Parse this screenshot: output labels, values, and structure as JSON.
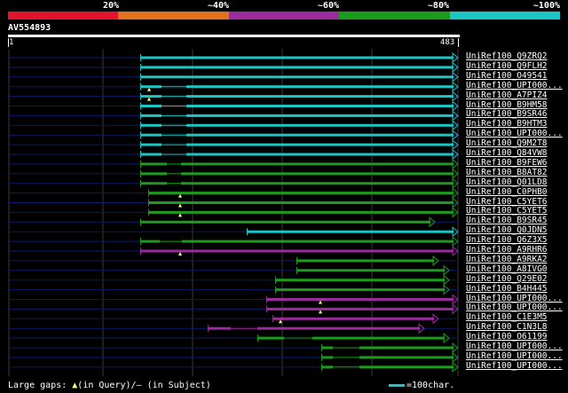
{
  "legend": {
    "segments": [
      {
        "label": "20%",
        "color": "#e4132c"
      },
      {
        "label": "~40%",
        "color": "#e2701d"
      },
      {
        "label": "~60%",
        "color": "#9b2c9d"
      },
      {
        "label": "~80%",
        "color": "#1c9b1c"
      },
      {
        "label": "~100%",
        "color": "#1cc6c6"
      }
    ]
  },
  "query": {
    "id": "AV554893",
    "start": "1",
    "end": "483"
  },
  "hits": [
    {
      "label": "UniRef100_Q9ZRQ2",
      "color": "cyan"
    },
    {
      "label": "UniRef100_Q9FLH2",
      "color": "cyan"
    },
    {
      "label": "UniRef100_O49541",
      "color": "cyan"
    },
    {
      "label": "UniRef100_UPI000...",
      "color": "cyan"
    },
    {
      "label": "UniRef100_A7PIZ4",
      "color": "cyan"
    },
    {
      "label": "UniRef100_B9HM58",
      "color": "cyan"
    },
    {
      "label": "UniRef100_B9SR46",
      "color": "cyan"
    },
    {
      "label": "UniRef100_B9HTM3",
      "color": "cyan"
    },
    {
      "label": "UniRef100_UPI000...",
      "color": "cyan"
    },
    {
      "label": "UniRef100_Q9M2T8",
      "color": "cyan"
    },
    {
      "label": "UniRef100_Q84VW8",
      "color": "cyan"
    },
    {
      "label": "UniRef100_B9FEW6",
      "color": "green"
    },
    {
      "label": "UniRef100_B8AT82",
      "color": "green"
    },
    {
      "label": "UniRef100_Q01LD8",
      "color": "green"
    },
    {
      "label": "UniRef100_C0PHB0",
      "color": "green"
    },
    {
      "label": "UniRef100_C5YET6",
      "color": "green"
    },
    {
      "label": "UniRef100_C5YET5",
      "color": "green"
    },
    {
      "label": "UniRef100_B9SR45",
      "color": "green"
    },
    {
      "label": "UniRef100_Q0JDN5",
      "color": "cyan"
    },
    {
      "label": "UniRef100_Q6Z3X5",
      "color": "green"
    },
    {
      "label": "UniRef100_A9RHR6",
      "color": "purple"
    },
    {
      "label": "UniRef100_A9RKA2",
      "color": "green"
    },
    {
      "label": "UniRef100_A8IVG0",
      "color": "green"
    },
    {
      "label": "UniRef100_Q29E02",
      "color": "green"
    },
    {
      "label": "UniRef100_B4H445",
      "color": "green"
    },
    {
      "label": "UniRef100_UPI000...",
      "color": "purple"
    },
    {
      "label": "UniRef100_UPI000...",
      "color": "purple"
    },
    {
      "label": "UniRef100_C1E3M5",
      "color": "purple"
    },
    {
      "label": "UniRef100_C1N3L8",
      "color": "purple"
    },
    {
      "label": "UniRef100_O61199",
      "color": "green"
    },
    {
      "label": "UniRef100_UPI000...",
      "color": "green"
    },
    {
      "label": "UniRef100_UPI000...",
      "color": "green"
    },
    {
      "label": "UniRef100_UPI000...",
      "color": "green"
    }
  ],
  "footer": {
    "large_gaps_prefix": "Large gaps:",
    "query_gap_marker": "▲",
    "query_gap_text": "(in Query)/",
    "subject_gap_marker": "–",
    "subject_gap_text": " (in Subject)",
    "scale_text": "=100char."
  },
  "colors": {
    "cyan": "#1cc6c6",
    "green": "#1c9b1c",
    "purple": "#9b2c9d",
    "track": "#0b1a6b",
    "grid": "#3a3a3a",
    "gap_marker": "#ffff80"
  }
}
